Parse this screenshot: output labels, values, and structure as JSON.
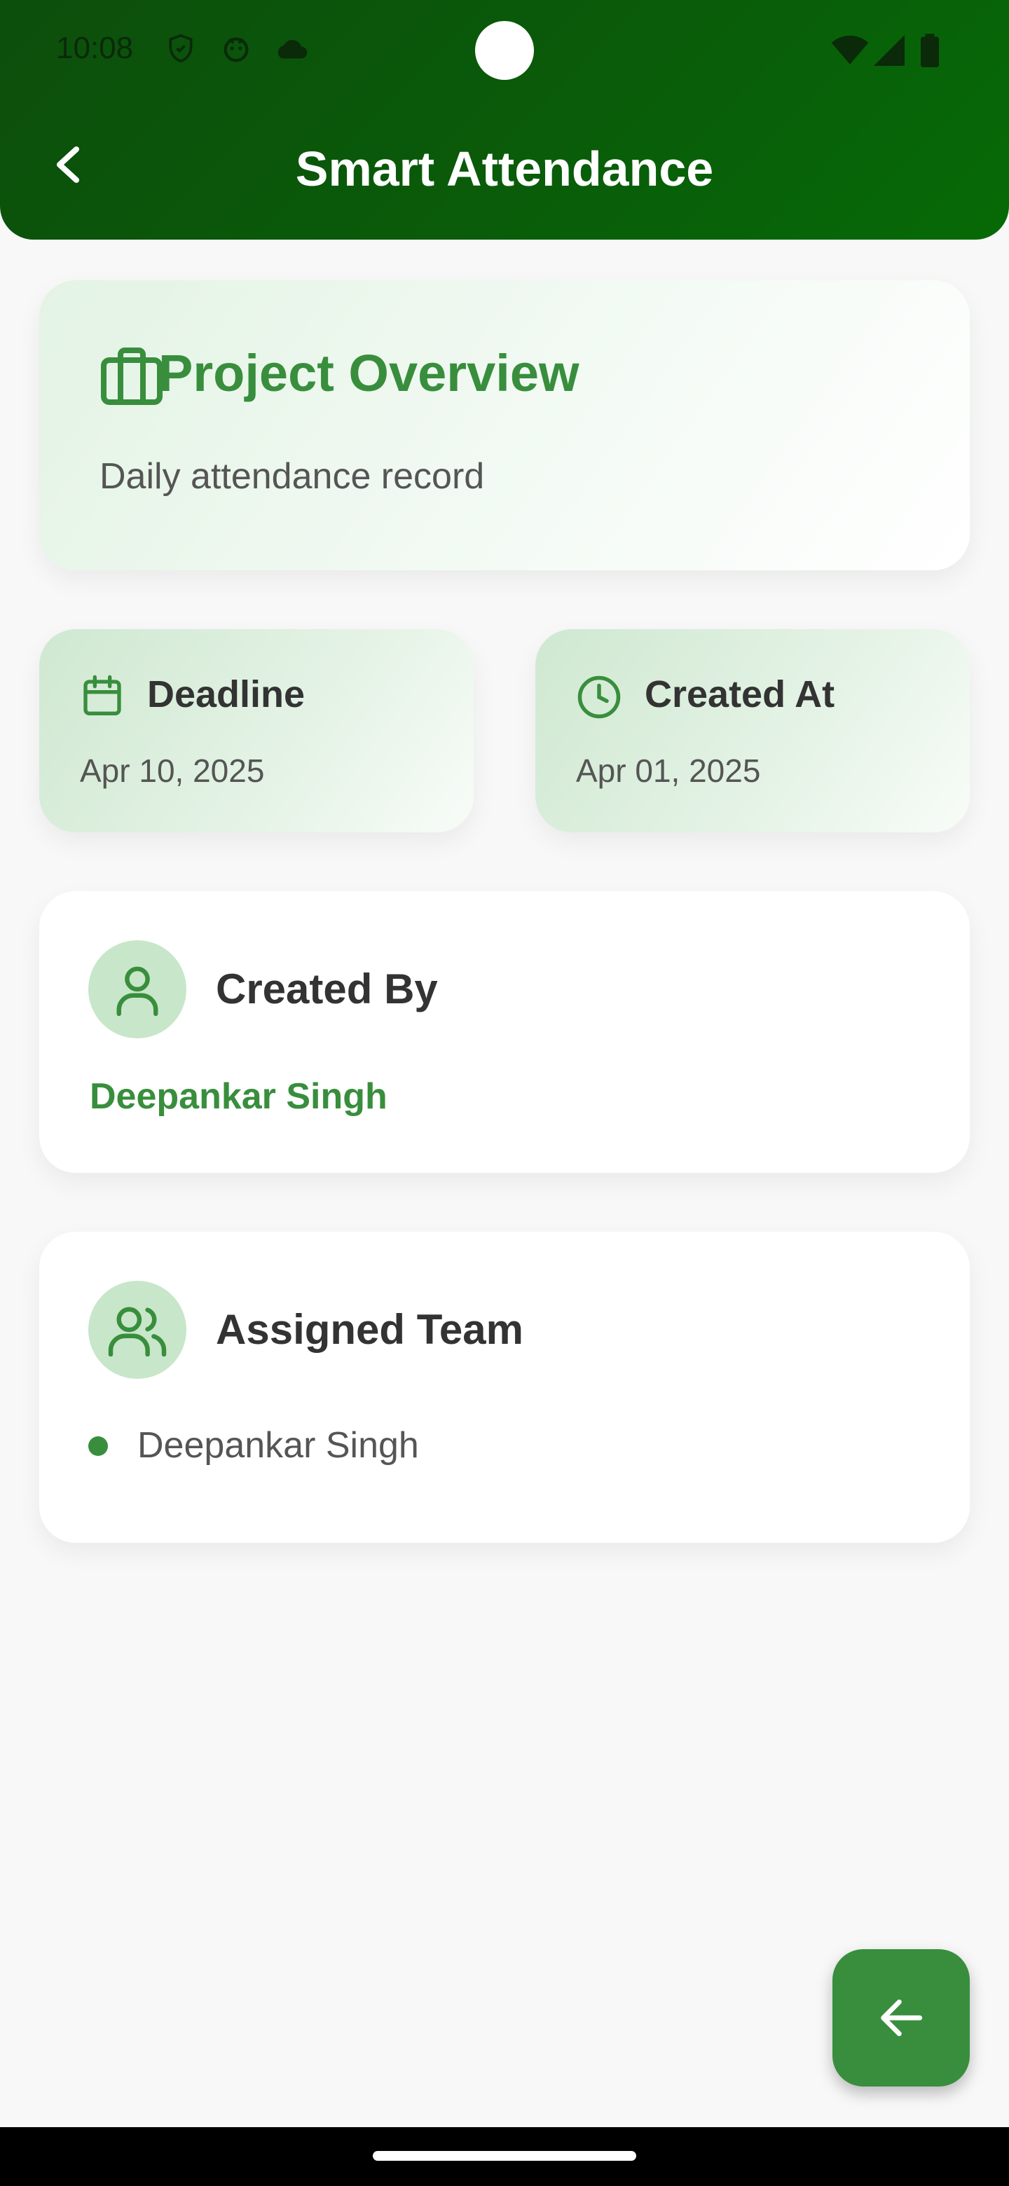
{
  "status_bar": {
    "time": "10:08"
  },
  "header": {
    "title": "Smart Attendance",
    "back_icon": "chevron-left-icon"
  },
  "overview": {
    "title": "Project Overview",
    "description": "Daily attendance record",
    "icon": "briefcase-icon"
  },
  "deadline": {
    "label": "Deadline",
    "value": "Apr 10, 2025",
    "icon": "calendar-icon"
  },
  "created_at": {
    "label": "Created At",
    "value": "Apr 01, 2025",
    "icon": "clock-icon"
  },
  "created_by": {
    "label": "Created By",
    "name": "Deepankar Singh",
    "icon": "user-icon"
  },
  "assigned_team": {
    "label": "Assigned Team",
    "members": [
      "Deepankar Singh"
    ],
    "icon": "users-icon"
  },
  "fab": {
    "icon": "arrow-left-icon"
  },
  "colors": {
    "brand_green": "#388e3c",
    "header_dark": "#0c4e0c",
    "avatar_bg": "#c8e6c9"
  }
}
